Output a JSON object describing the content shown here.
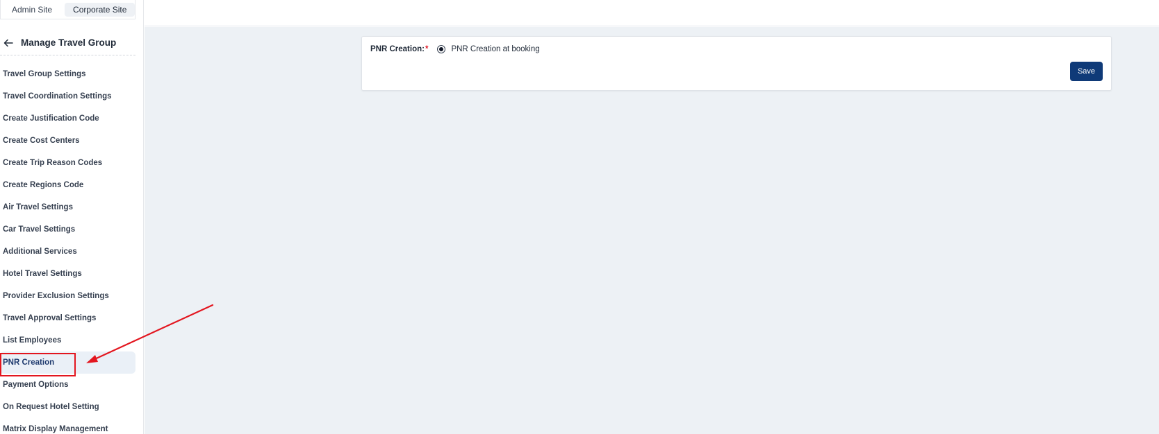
{
  "site_switch": {
    "tabs": [
      {
        "label": "Admin Site",
        "active": false
      },
      {
        "label": "Corporate Site",
        "active": true
      }
    ]
  },
  "sidebar": {
    "back_icon": "arrow-left-icon",
    "title": "Manage Travel Group",
    "items": [
      {
        "label": "Travel Group Settings"
      },
      {
        "label": "Travel Coordination Settings"
      },
      {
        "label": "Create Justification Code"
      },
      {
        "label": "Create Cost Centers"
      },
      {
        "label": "Create Trip Reason Codes"
      },
      {
        "label": "Create Regions Code"
      },
      {
        "label": "Air Travel Settings"
      },
      {
        "label": "Car Travel Settings"
      },
      {
        "label": "Additional Services"
      },
      {
        "label": "Hotel Travel Settings"
      },
      {
        "label": "Provider Exclusion Settings"
      },
      {
        "label": "Travel Approval Settings"
      },
      {
        "label": "List Employees"
      },
      {
        "label": "PNR Creation",
        "active": true
      },
      {
        "label": "Payment Options"
      },
      {
        "label": "On Request Hotel Setting"
      },
      {
        "label": "Matrix Display Management"
      }
    ]
  },
  "form": {
    "field_label": "PNR Creation:",
    "required_mark": "*",
    "option_label": "PNR Creation at booking",
    "option_selected": true,
    "save_label": "Save"
  },
  "colors": {
    "primary": "#0f3a78",
    "required": "#e11d2a",
    "annotation": "#e3161f",
    "main_bg": "#edf1f5",
    "active_item_bg": "#eaf0f7"
  }
}
